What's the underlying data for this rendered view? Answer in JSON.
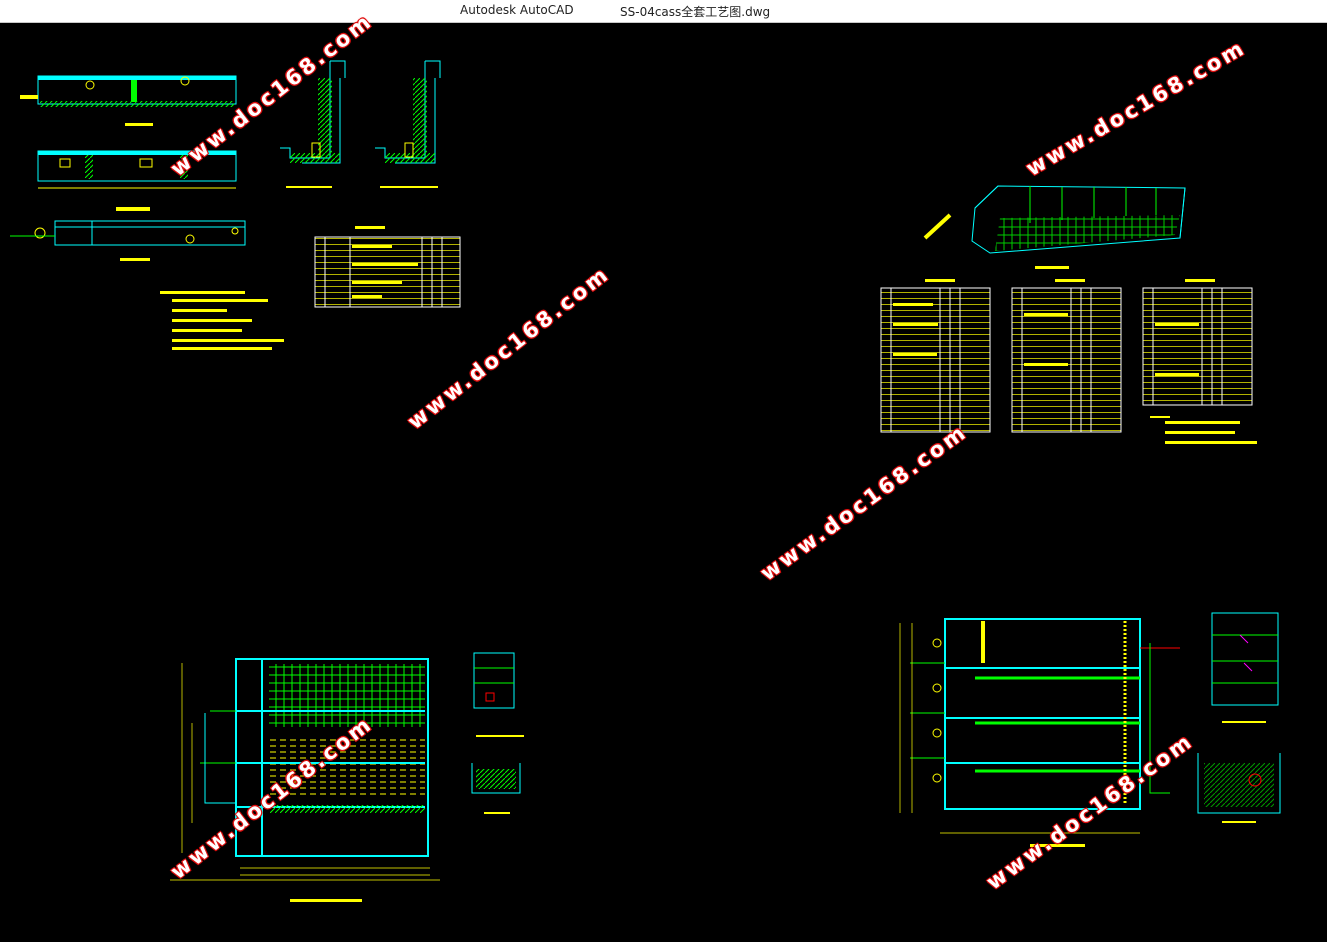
{
  "window": {
    "app_name": "Autodesk AutoCAD",
    "document_name": "SS-04cass全套工艺图.dwg"
  },
  "watermarks": [
    "www.doc168.com",
    "www.doc168.com",
    "www.doc168.com",
    "www.doc168.com",
    "www.doc168.com",
    "www.doc168.com"
  ],
  "colors": {
    "background": "#000000",
    "cyan": "#00ffff",
    "green": "#00ff00",
    "yellow": "#ffff00",
    "white": "#ffffff",
    "red": "#ff0000",
    "magenta": "#ff00ff"
  }
}
